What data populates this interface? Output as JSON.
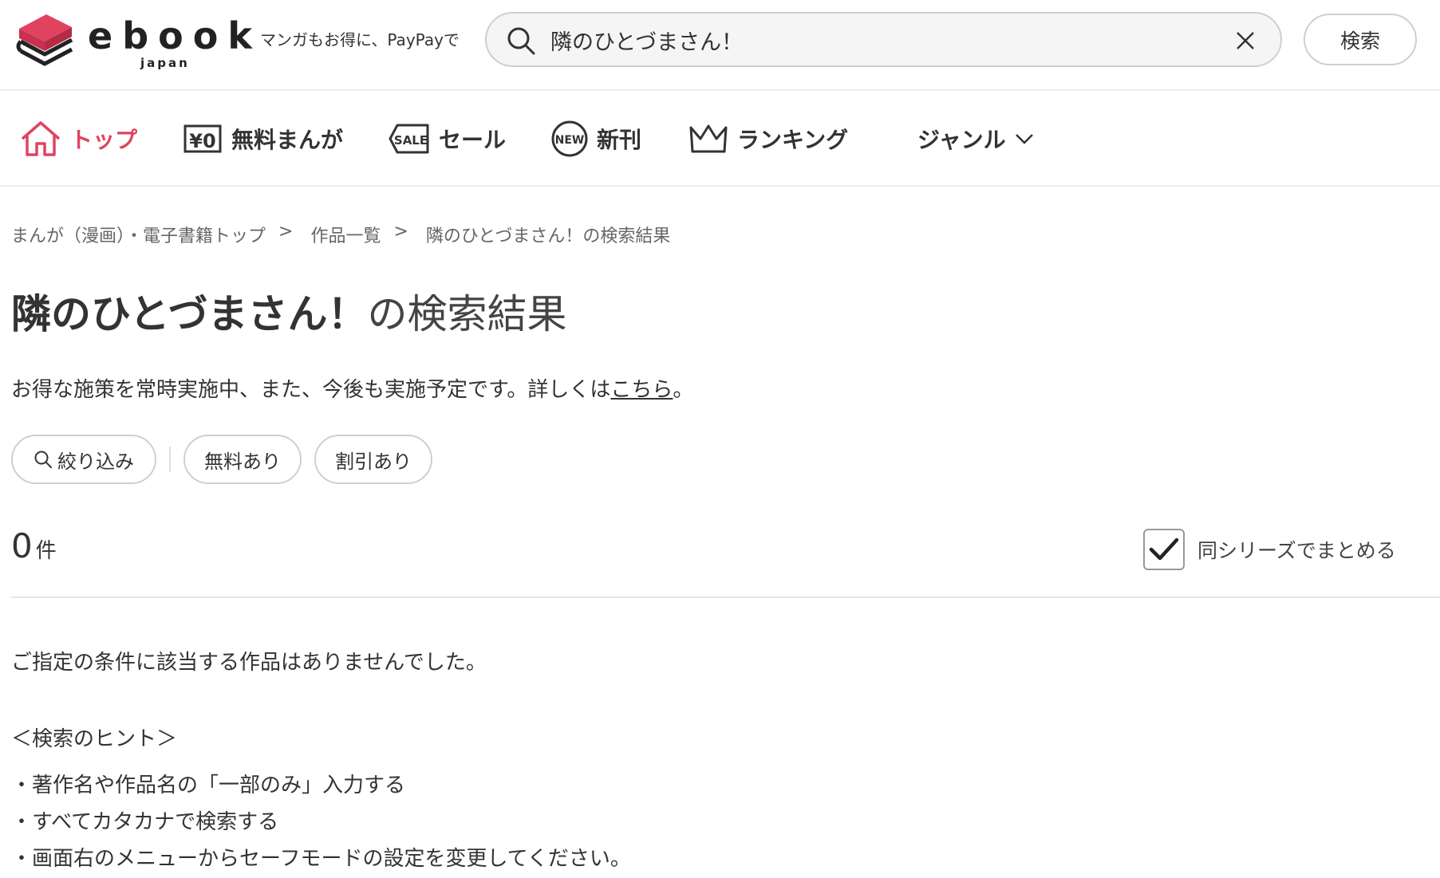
{
  "header": {
    "logo_word": "ebook",
    "logo_sub": "japan",
    "tagline": "マンガもお得に、PayPayで",
    "search_value": "隣のひとづまさん！",
    "search_button": "検索"
  },
  "nav": [
    {
      "label": "トップ",
      "icon": "home-icon",
      "active": true
    },
    {
      "label": "無料まんが",
      "icon": "free-yen-icon"
    },
    {
      "label": "セール",
      "icon": "sale-tag-icon"
    },
    {
      "label": "新刊",
      "icon": "new-badge-icon"
    },
    {
      "label": "ランキング",
      "icon": "crown-icon"
    },
    {
      "label": "ジャンル",
      "icon": "chevron-down-icon"
    }
  ],
  "colors": {
    "accent": "#e0435f",
    "text": "#333333",
    "border": "#cfcfcf"
  },
  "breadcrumb": {
    "items": [
      "まんが（漫画）・電子書籍トップ",
      "作品一覧",
      "隣のひとづまさん！の検索結果"
    ],
    "separator": ">"
  },
  "title": {
    "query": "隣のひとづまさん！",
    "suffix": "の検索結果"
  },
  "notice": {
    "text": "お得な施策を常時実施中、また、今後も実施予定です。詳しくは",
    "link": "こちら",
    "end": "。"
  },
  "filters": {
    "refine": "絞り込み",
    "free": "無料あり",
    "discount": "割引あり"
  },
  "results": {
    "count": "0",
    "unit": "件",
    "series_toggle": "同シリーズでまとめる",
    "series_checked": true
  },
  "empty": {
    "message": "ご指定の条件に該当する作品はありませんでした。",
    "hint_title": "＜検索のヒント＞",
    "hints": [
      "・著作名や作品名の「一部のみ」入力する",
      "・すべてカタカナで検索する",
      "・画面右のメニューからセーフモードの設定を変更してください。"
    ]
  }
}
